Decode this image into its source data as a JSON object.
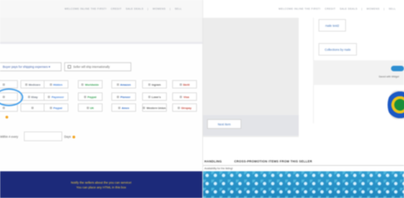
{
  "topbar_left": {
    "items": [
      "WELCOME INLINE THE FIRST!",
      "CREDIT",
      "SALE DEALS",
      "|",
      "WOMENS",
      "|",
      "SELL"
    ]
  },
  "topbar_right": {
    "items": [
      "WELCOME INLINE THE FIRST!",
      "CREDIT",
      "SALE DEALS",
      "|",
      "WOMENS",
      "|",
      "SELL"
    ]
  },
  "shipping": {
    "select_value": "Buyer pays for shipping expenses ▾",
    "checkbox_label": "Seller will ship internationally"
  },
  "logo_rows": [
    [
      "",
      "Medicare",
      "Hidden",
      "Worldwide",
      "Amazon",
      "ingram",
      "Skrill"
    ],
    [
      "",
      "Ebay",
      "Payoneer",
      "Paypal",
      "Pioneer",
      "Lowe's",
      "Visa"
    ],
    [
      "",
      "",
      "Paypal",
      "UK",
      "Amex",
      "Western Union",
      "Giropay"
    ]
  ],
  "handling": {
    "star_note": "",
    "days_prefix": "Within 4 every",
    "days_suffix": "Days"
  },
  "footer_banner": {
    "line1": "Notify the sellers about the you can service!",
    "line2": "You can place any HTML in this box"
  },
  "right_pane": {
    "next_item": "Next Item",
    "collection_btn1": "rsale test2",
    "collection_btn2": "Collections by rsale",
    "save_text": "Saved with Widget"
  },
  "tabs": {
    "tab1": "HANDLING",
    "tab2": "CROSS-PROMOTION ITEMS FROM THIS SELLER",
    "note": "Availability for the listing!"
  },
  "colors": {
    "banner_bg": "#1c2a7a",
    "banner_text": "#f4d03f",
    "accent": "#2d8ed1"
  }
}
